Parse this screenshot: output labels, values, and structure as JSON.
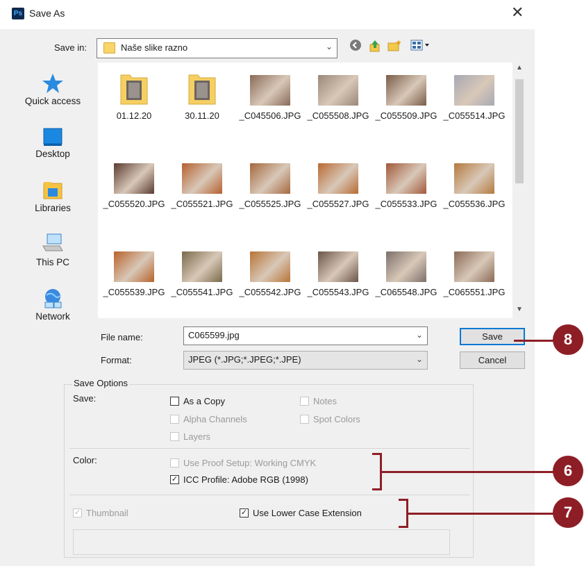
{
  "window": {
    "app_icon": "Ps",
    "title": "Save As",
    "close": "✕"
  },
  "toolbar": {
    "save_in_label": "Save in:",
    "save_in_value": "Naše slike razno",
    "icons": [
      "back-icon",
      "up-folder-icon",
      "new-folder-icon",
      "view-menu-icon"
    ]
  },
  "places": [
    {
      "label": "Quick access",
      "icon": "star-icon"
    },
    {
      "label": "Desktop",
      "icon": "desktop-icon"
    },
    {
      "label": "Libraries",
      "icon": "libraries-icon"
    },
    {
      "label": "This PC",
      "icon": "computer-icon"
    },
    {
      "label": "Network",
      "icon": "network-icon"
    }
  ],
  "files": [
    {
      "name": "01.12.20",
      "type": "folder"
    },
    {
      "name": "30.11.20",
      "type": "folder"
    },
    {
      "name": "_C045506.JPG",
      "type": "image",
      "color": "#8a6a58"
    },
    {
      "name": "_C055508.JPG",
      "type": "image",
      "color": "#9a8878"
    },
    {
      "name": "_C055509.JPG",
      "type": "image",
      "color": "#7a5c48"
    },
    {
      "name": "_C055514.JPG",
      "type": "image",
      "color": "#a8a8b4"
    },
    {
      "name": "_C055520.JPG",
      "type": "image",
      "color": "#5a3a30"
    },
    {
      "name": "_C055521.JPG",
      "type": "image",
      "color": "#b4602e"
    },
    {
      "name": "_C055525.JPG",
      "type": "image",
      "color": "#a4683c"
    },
    {
      "name": "_C055527.JPG",
      "type": "image",
      "color": "#b86a32"
    },
    {
      "name": "_C055533.JPG",
      "type": "image",
      "color": "#a2583a"
    },
    {
      "name": "_C055536.JPG",
      "type": "image",
      "color": "#b47a3e"
    },
    {
      "name": "_C055539.JPG",
      "type": "image",
      "color": "#b8622a"
    },
    {
      "name": "_C055541.JPG",
      "type": "image",
      "color": "#7a6a4a"
    },
    {
      "name": "_C055542.JPG",
      "type": "image",
      "color": "#b87436"
    },
    {
      "name": "_C055543.JPG",
      "type": "image",
      "color": "#6a5448"
    },
    {
      "name": "_C065548.JPG",
      "type": "image",
      "color": "#7c706a"
    },
    {
      "name": "_C065551.JPG",
      "type": "image",
      "color": "#8a6a56"
    }
  ],
  "form": {
    "file_name_label": "File name:",
    "file_name_value": "C065599.jpg",
    "format_label": "Format:",
    "format_value": "JPEG (*.JPG;*.JPEG;*.JPE)",
    "save_button": "Save",
    "cancel_button": "Cancel"
  },
  "options": {
    "title": "Save Options",
    "save_label": "Save:",
    "as_a_copy": {
      "label": "As a Copy",
      "checked": false,
      "enabled": true
    },
    "notes": {
      "label": "Notes",
      "checked": false,
      "enabled": false
    },
    "alpha_channels": {
      "label": "Alpha Channels",
      "checked": false,
      "enabled": false
    },
    "spot_colors": {
      "label": "Spot Colors",
      "checked": false,
      "enabled": false
    },
    "layers": {
      "label": "Layers",
      "checked": false,
      "enabled": false
    },
    "color_label": "Color:",
    "use_proof_setup": {
      "label": "Use Proof Setup:  Working CMYK",
      "checked": false,
      "enabled": false
    },
    "icc_profile": {
      "label": "ICC Profile:  Adobe RGB (1998)",
      "checked": true,
      "enabled": true
    },
    "thumbnail": {
      "label": "Thumbnail",
      "checked": true,
      "enabled": false
    },
    "lower_case_ext": {
      "label": "Use Lower Case Extension",
      "checked": true,
      "enabled": true
    }
  },
  "callouts": [
    "8",
    "6",
    "7"
  ],
  "colors": {
    "callout": "#8e1e26",
    "accent": "#0078d7"
  }
}
